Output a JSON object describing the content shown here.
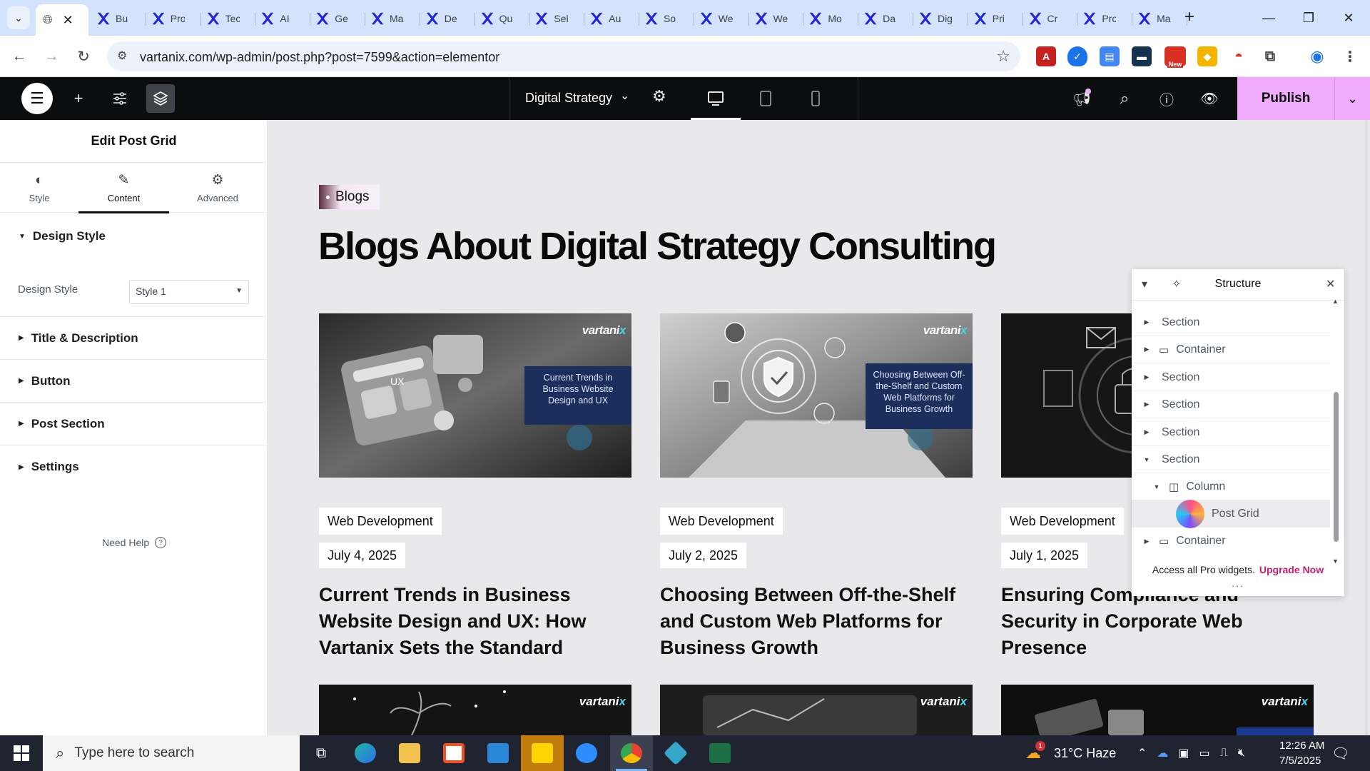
{
  "browser": {
    "active_tab_icon": "globe-icon",
    "tabs": [
      "Bu",
      "Pro",
      "Tec",
      "AI",
      "Ge",
      "Ma",
      "De",
      "Qu",
      "Sel",
      "Au",
      "So",
      "We",
      "We",
      "Mo",
      "Da",
      "Dig",
      "Pri",
      "Cr",
      "Pro",
      "Ma"
    ],
    "url": "vartanix.com/wp-admin/post.php?post=7599&action=elementor",
    "ext_new_badge": "New"
  },
  "elementor": {
    "document_title": "Digital Strategy",
    "publish_label": "Publish"
  },
  "panel": {
    "title": "Edit Post Grid",
    "tabs": [
      {
        "label": "Style",
        "icon": "half-circle-icon"
      },
      {
        "label": "Content",
        "icon": "pencil-icon"
      },
      {
        "label": "Advanced",
        "icon": "gear-icon"
      }
    ],
    "sections": {
      "design_style": "Design Style",
      "title_description": "Title & Description",
      "button": "Button",
      "post_section": "Post Section",
      "settings": "Settings"
    },
    "design_style_label": "Design Style",
    "design_style_value": "Style 1",
    "need_help": "Need Help"
  },
  "canvas": {
    "badge": "Blogs",
    "headline": "Blogs About Digital Strategy Consulting",
    "brand_text": "vartani",
    "brand_x": "x",
    "posts": [
      {
        "caption": "Current Trends in Business Website Design and UX",
        "category": "Web Development",
        "date": "July 4, 2025",
        "title": "Current Trends in Business Website Design and UX: How Vartanix Sets the Standard"
      },
      {
        "caption": "Choosing Between Off-the-Shelf and Custom Web Platforms for Business Growth",
        "category": "Web Development",
        "date": "July 2, 2025",
        "title": "Choosing Between Off-the-Shelf and Custom Web Platforms for Business Growth"
      },
      {
        "caption": "",
        "category": "Web Development",
        "date": "July 1, 2025",
        "title": "Ensuring Compliance and Security in Corporate Web Presence"
      }
    ]
  },
  "structure": {
    "title": "Structure",
    "rows": [
      "Section",
      "Container",
      "Section",
      "Section",
      "Section",
      "Section",
      "Column",
      "Post Grid",
      "Container"
    ],
    "footer_text": "Access all Pro widgets.",
    "footer_link": "Upgrade Now",
    "more": "..."
  },
  "taskbar": {
    "search_placeholder": "Type here to search",
    "weather": "31°C  Haze",
    "weather_alert": "1",
    "time": "12:26 AM",
    "date": "7/5/2025"
  },
  "colors": {
    "publish": "#f0abfc",
    "elementor_bar": "#0c0d0e",
    "upgrade_link": "#c41f6c",
    "tab_strip": "#d3e3fd"
  }
}
